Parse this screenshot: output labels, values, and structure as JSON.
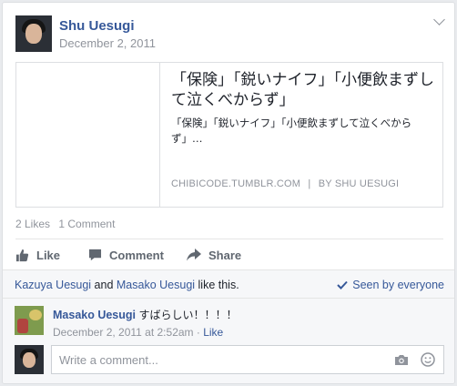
{
  "post": {
    "author": "Shu Uesugi",
    "date": "December 2, 2011"
  },
  "link": {
    "title": "「保険」「鋭いナイフ」「小便飲まずして泣くべからず」",
    "description": "「保険」「鋭いナイフ」「小便飲まずして泣くべからず」…",
    "domain": "CHIBICODE.TUMBLR.COM",
    "separator": "|",
    "byline": "BY SHU UESUGI"
  },
  "counts": {
    "likes": "2 Likes",
    "comments": "1 Comment"
  },
  "actions": {
    "like": "Like",
    "comment": "Comment",
    "share": "Share"
  },
  "liked_by": {
    "user1": "Kazuya Uesugi",
    "and": " and ",
    "user2": "Masako Uesugi",
    "suffix": " like this.",
    "seen": "Seen by everyone"
  },
  "comment": {
    "author": "Masako Uesugi",
    "text": "すばらしい！！！！",
    "timestamp": "December 2, 2011 at 2:52am",
    "dot": " · ",
    "like": "Like"
  },
  "composer": {
    "placeholder": "Write a comment..."
  },
  "icons": [
    "chevron-down-icon",
    "like-thumb-icon",
    "comment-bubble-icon",
    "share-arrow-icon",
    "checkmark-icon",
    "camera-icon",
    "smiley-icon"
  ],
  "colors": {
    "link": "#365899",
    "muted": "#90949c",
    "action": "#606770"
  }
}
